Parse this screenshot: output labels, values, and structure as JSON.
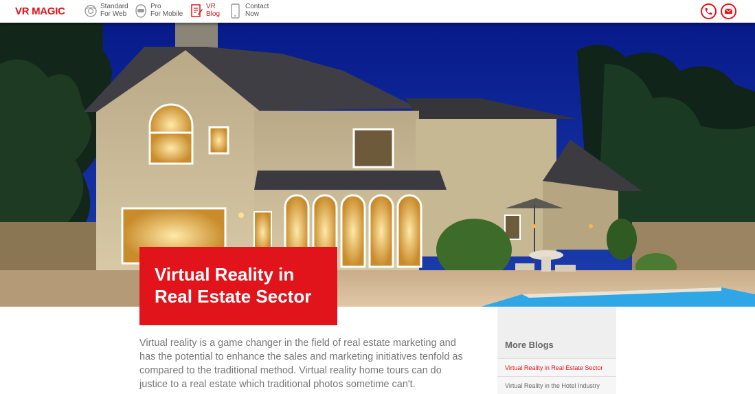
{
  "brand": {
    "logo_text": "VR MAGIC"
  },
  "nav": {
    "items": [
      {
        "line1": "Standard",
        "line2": "For Web",
        "icon": "panorama-icon",
        "active": false
      },
      {
        "line1": "Pro",
        "line2": "For Mobile",
        "icon": "vr-headset-icon",
        "active": false
      },
      {
        "line1": "VR",
        "line2": "Blog",
        "icon": "blog-edit-icon",
        "active": true
      },
      {
        "line1": "Contact",
        "line2": "Now",
        "icon": "mobile-phone-icon",
        "active": false
      }
    ],
    "actions": [
      {
        "icon": "phone-icon"
      },
      {
        "icon": "email-icon"
      }
    ]
  },
  "hero": {
    "image_alt": "house-at-night-image",
    "title_line1": "Virtual Reality in",
    "title_line2": "Real Estate Sector"
  },
  "article": {
    "intro": "Virtual reality is a game changer in the field of real estate marketing and has the potential to enhance the sales and marketing initiatives tenfold as compared to the traditional method. Virtual reality home tours can do justice to a real estate which traditional photos sometime can't."
  },
  "sidebar": {
    "heading": "More Blogs",
    "links": [
      {
        "label": "Virtual Reality in Real Estate Sector",
        "active": true
      },
      {
        "label": "Virtual Reality in the Hotel Industry",
        "active": false
      }
    ]
  },
  "colors": {
    "accent": "#e0141a",
    "text_muted": "#777777",
    "sidebar_bg": "#efefef"
  }
}
